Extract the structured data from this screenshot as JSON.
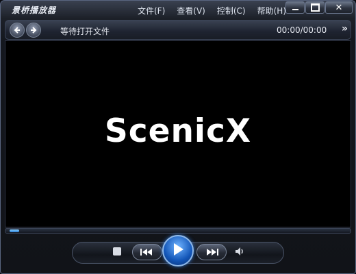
{
  "window": {
    "title": "景桥播放器",
    "menu": [
      "文件(F)",
      "查看(V)",
      "控制(C)",
      "帮助(H)"
    ]
  },
  "nav": {
    "status": "等待打开文件",
    "time": "00:00/00:00",
    "more": "»"
  },
  "video": {
    "logo": "ScenicX"
  },
  "icons": {
    "back": "arrow-left-icon",
    "forward": "arrow-right-icon",
    "stop": "stop-icon",
    "prev": "skip-previous-icon",
    "play": "play-icon",
    "next": "skip-next-icon",
    "volume": "volume-icon"
  },
  "colors": {
    "accent": "#1a6fd6",
    "text": "#e6e9f0"
  },
  "playback": {
    "progress": 0
  }
}
